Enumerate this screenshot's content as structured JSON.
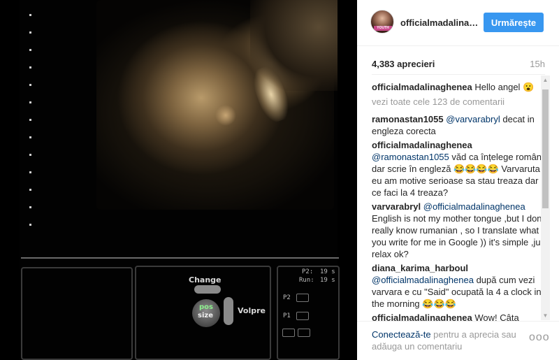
{
  "header": {
    "username": "officialmadalinaghenea",
    "follow_label": "Urmărește",
    "avatar_badge": "YOUTH"
  },
  "stats": {
    "likes": "4,383 aprecieri",
    "time": "15h"
  },
  "caption": {
    "user": "officialmadalinaghenea",
    "text": "Hello angel 😮"
  },
  "view_all": "vezi toate cele 123 de comentarii",
  "comments": [
    {
      "user": "ramonastan1055",
      "mention": "@varvarabryl",
      "text": " decat in engleza corecta"
    },
    {
      "user": "officialmadalinaghenea",
      "mention": "@ramonastan1055",
      "text": " văd ca înțelege româna dar scrie în engleză 😂😂😂😂 Varvaruta, eu am motive serioase sa stau treaza dar tu ce faci la 4 treaza?"
    },
    {
      "user": "varvarabryl",
      "mention": "@officialmadalinaghenea",
      "text": " English is not my mother tongue ,but I don't really know rumanian , so I translate what you write for me in Google )) it's simple ,just relax ok?"
    },
    {
      "user": "diana_karima_harboul",
      "mention": "@officialmadalinaghenea",
      "text": " după cum vezi varvara e cu \"Said\" ocupată la 4 a clock in the morning 😂😂😂"
    },
    {
      "user": "officialmadalinaghenea",
      "mention": "",
      "text": " Wow! Câta pasiune! Ce încerci tu sa dovedești aici?"
    }
  ],
  "footer": {
    "login_link": "Conectează-te",
    "login_text": " pentru a aprecia sau adăuga un comentariu",
    "more": "ooo"
  },
  "ultrasound": {
    "change": "Change",
    "volpre": "Volpre",
    "knob_top": "pos",
    "knob_bottom": "size",
    "p2": "P2:",
    "run": "Run:",
    "val1": "19 s",
    "val2": "19 s",
    "p2_tag": "P2",
    "p1_tag": "P1"
  },
  "colors": {
    "follow_button": "#3897f0",
    "link": "#003569",
    "muted": "#999999",
    "text": "#262626"
  }
}
